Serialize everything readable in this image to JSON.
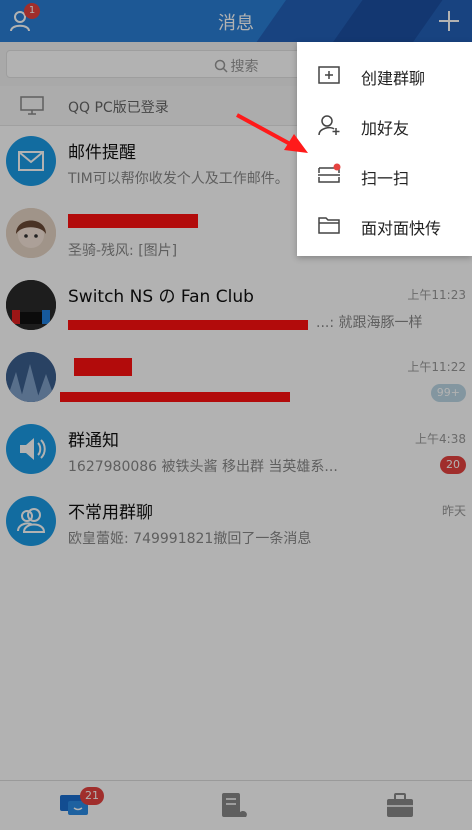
{
  "header": {
    "title": "消息",
    "profile_badge": "1"
  },
  "search": {
    "placeholder": "搜索"
  },
  "pc_login": {
    "text": "QQ PC版已登录"
  },
  "conversations": [
    {
      "name": "邮件提醒",
      "preview": "TIM可以帮你收发个人及工作邮件。",
      "time": "",
      "count": ""
    },
    {
      "name": "",
      "preview": "圣骑-残风: [图片]",
      "time": "",
      "count": ""
    },
    {
      "name": "Switch NS の Fan Club",
      "preview": "...: 就跟海豚一样",
      "time": "上午11:23",
      "count": ""
    },
    {
      "name": "",
      "preview": "",
      "time": "上午11:22",
      "count": "99+"
    },
    {
      "name": "群通知",
      "preview": "1627980086 被铁头酱 移出群 当英雄系...",
      "time": "上午4:38",
      "count": "20"
    },
    {
      "name": "不常用群聊",
      "preview": "欧皇蕾姬: 749991821撤回了一条消息",
      "time": "昨天",
      "count": ""
    }
  ],
  "menu": {
    "items": [
      {
        "label": "创建群聊",
        "icon": "add-group-icon"
      },
      {
        "label": "加好友",
        "icon": "add-friend-icon"
      },
      {
        "label": "扫一扫",
        "icon": "scan-icon"
      },
      {
        "label": "面对面快传",
        "icon": "folder-icon"
      }
    ]
  },
  "tabbar": {
    "messages_badge": "21"
  },
  "colors": {
    "header": "#2a7fd6",
    "badge_red": "#e64340",
    "badge_gray": "#bcd7e6",
    "redaction": "#ff1111"
  }
}
